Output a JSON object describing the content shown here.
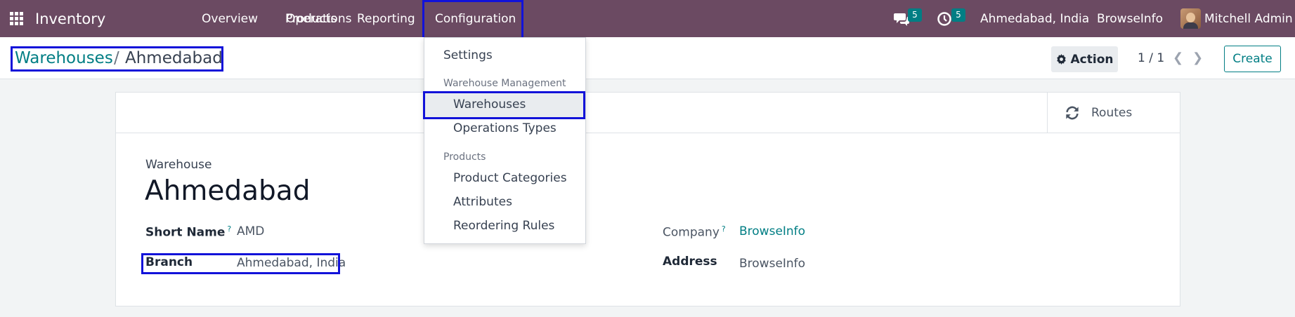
{
  "navbar": {
    "app_name": "Inventory",
    "menu": [
      "Overview",
      "Operations",
      "Products",
      "Reporting",
      "Configuration"
    ],
    "messages_count": "5",
    "activities_count": "5",
    "company_branch": "Ahmedabad, India",
    "company": "BrowseInfo",
    "user": "Mitchell Admin",
    "bg_color": "#6b4a62"
  },
  "breadcrumb": {
    "parent": "Warehouses",
    "separator": "/",
    "current": "Ahmedabad"
  },
  "controls": {
    "action_label": "Action",
    "pager": "1 / 1",
    "create_label": "Create"
  },
  "form": {
    "routes_label": "Routes",
    "warehouse_label": "Warehouse",
    "warehouse_name": "Ahmedabad",
    "short_name_label": "Short Name",
    "short_name_value": "AMD",
    "branch_label": "Branch",
    "branch_value": "Ahmedabad, India",
    "company_label": "Company",
    "company_value": "BrowseInfo",
    "address_label": "Address",
    "address_value": "BrowseInfo",
    "help_mark": "?"
  },
  "dropdown": {
    "settings": "Settings",
    "section_warehouse": "Warehouse Management",
    "warehouses": "Warehouses",
    "operation_types": "Operations Types",
    "section_products": "Products",
    "product_categories": "Product Categories",
    "attributes": "Attributes",
    "reordering_rules": "Reordering Rules"
  },
  "accent_color": "#017e84",
  "highlight_color": "#1212d9"
}
